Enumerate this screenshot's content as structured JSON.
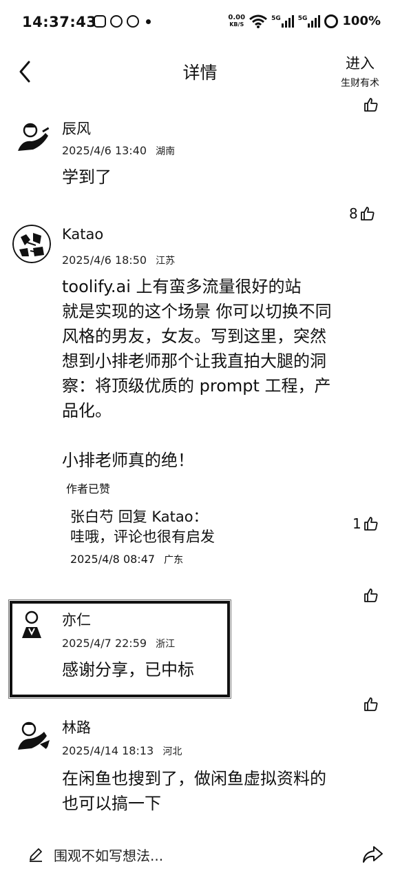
{
  "status_bar": {
    "time": "14:37:43",
    "net_speed_value": "0.00",
    "net_speed_unit": "KB/S",
    "signal1_label": "5G",
    "signal2_label": "5G",
    "battery": "100%"
  },
  "header": {
    "title": "详情",
    "enter_label": "进入",
    "enter_sub": "生财有术"
  },
  "comments": [
    {
      "name": "辰风",
      "date": "2025/4/6 13:40",
      "location": "湖南",
      "body": "学到了",
      "likes": "8"
    },
    {
      "name": "Katao",
      "date": "2025/4/6 18:50",
      "location": "江苏",
      "body_lines": [
        "toolify.ai 上有蛮多流量很好的站",
        "就是实现的这个场景 你可以切换不同",
        "风格的男友，女友。写到这里，突然",
        "想到小排老师那个让我直拍大腿的洞",
        "察：将顶级优质的 prompt 工程，产",
        "品化。",
        "",
        "小排老师真的绝！"
      ],
      "author_liked": "作者已赞",
      "reply": {
        "name": "张白芍",
        "action": "回复",
        "target": "Katao：",
        "text": "哇哦，评论也很有启发",
        "date": "2025/4/8 08:47",
        "location": "广东",
        "likes": "1"
      },
      "likes": ""
    },
    {
      "name": "亦仁",
      "date": "2025/4/7 22:59",
      "location": "浙江",
      "body": "感谢分享，已中标",
      "likes": ""
    },
    {
      "name": "林路",
      "date": "2025/4/14 18:13",
      "location": "河北",
      "body_lines": [
        "在闲鱼也搜到了，做闲鱼虚拟资料的",
        "也可以搞一下"
      ],
      "likes": ""
    }
  ],
  "bottom_bar": {
    "placeholder": "围观不如写想法..."
  },
  "icons": {
    "back": "chevron-left-icon",
    "like": "thumbs-up-icon",
    "share": "share-arrow-icon",
    "pen": "pen-icon"
  }
}
